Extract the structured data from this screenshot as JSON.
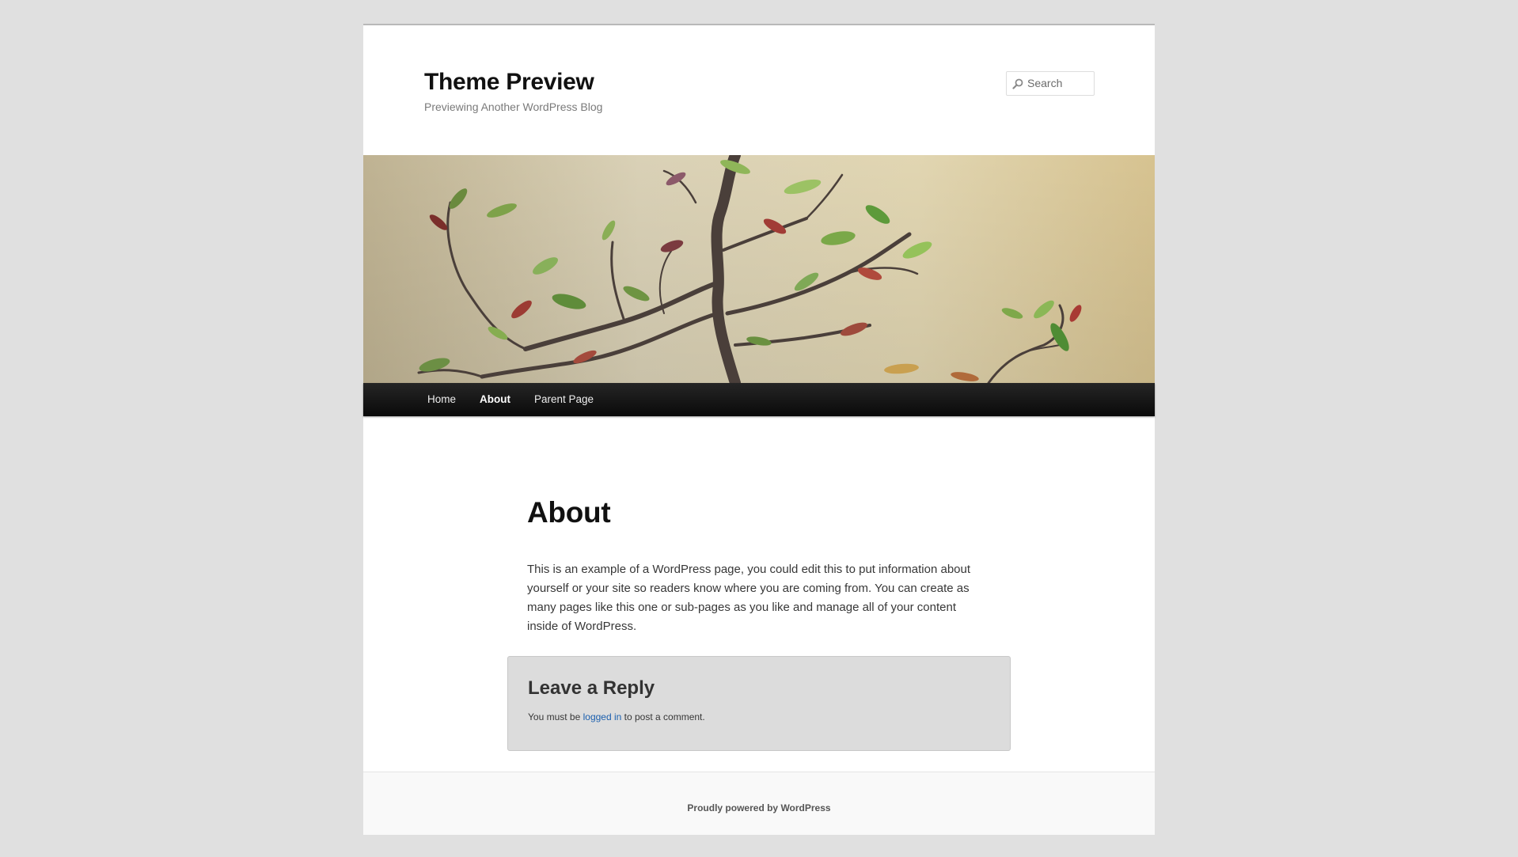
{
  "header": {
    "site_title": "Theme Preview",
    "site_description": "Previewing Another WordPress Blog",
    "search_placeholder": "Search",
    "search_icon": "search-icon"
  },
  "nav": {
    "items": [
      {
        "label": "Home",
        "current": false
      },
      {
        "label": "About",
        "current": true
      },
      {
        "label": "Parent Page",
        "current": false
      }
    ]
  },
  "main": {
    "title": "About",
    "content": "This is an example of a WordPress page, you could edit this to put information about yourself or your site so readers know where you are coming from. You can create as many pages like this one or sub-pages as you like and manage all of your content inside of WordPress."
  },
  "comments": {
    "reply_title": "Leave a Reply",
    "must_log_in_prefix": "You must be ",
    "login_link": "logged in",
    "must_log_in_suffix": " to post a comment."
  },
  "footer": {
    "credit": "Proudly powered by WordPress"
  },
  "colors": {
    "background": "#e0e0e0",
    "page": "#ffffff",
    "nav_bar": "#111111",
    "link": "#1b5fae",
    "reply_box": "#dcdcdc",
    "footer": "#f9f9f9"
  }
}
